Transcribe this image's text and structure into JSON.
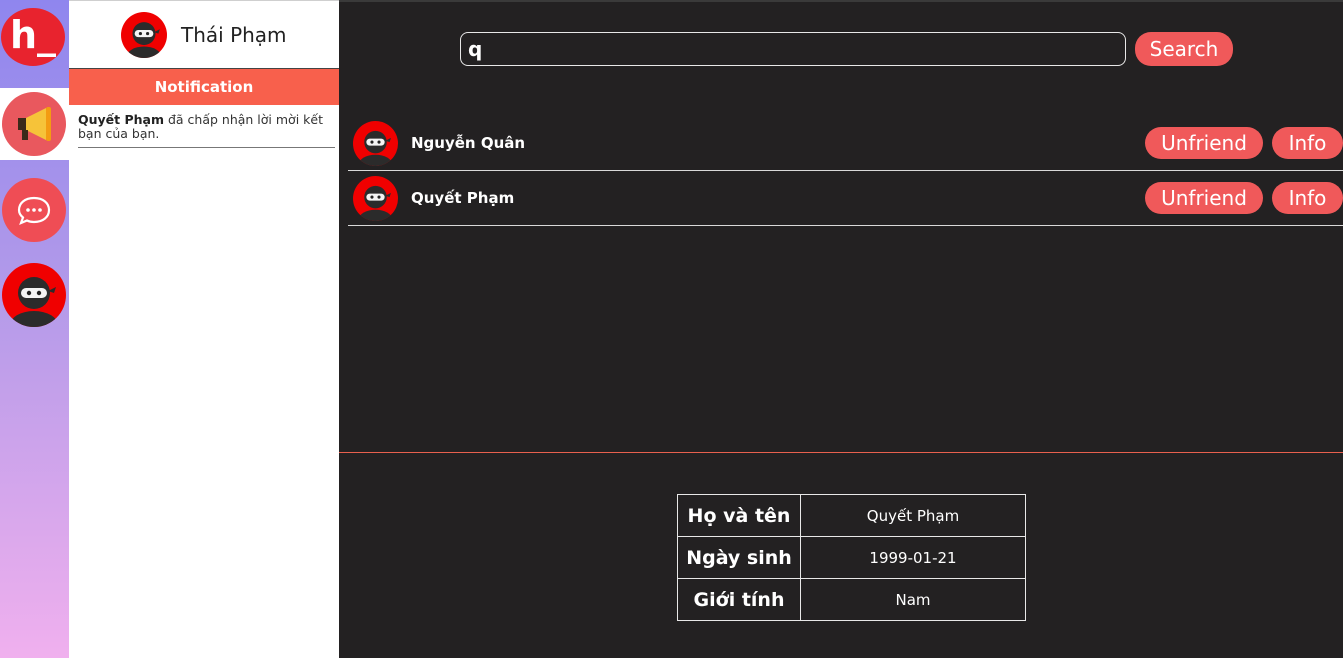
{
  "app": {
    "logo_text": "h_"
  },
  "rail": {
    "items": [
      {
        "icon": "megaphone-icon",
        "active": true
      },
      {
        "icon": "chat-bubble-icon",
        "active": false
      },
      {
        "icon": "ninja-avatar-icon",
        "active": false
      }
    ]
  },
  "panel": {
    "username": "Thái Phạm",
    "section_title": "Notification",
    "notifications": [
      {
        "actor": "Quyết Phạm",
        "message": " đã chấp nhận lời mời kết bạn của bạn."
      }
    ]
  },
  "search": {
    "value": "q",
    "button_label": "Search"
  },
  "friends": [
    {
      "name": "Nguyễn Quân",
      "unfriend_label": "Unfriend",
      "info_label": "Info"
    },
    {
      "name": "Quyết Phạm",
      "unfriend_label": "Unfriend",
      "info_label": "Info"
    }
  ],
  "profile_info": [
    {
      "label": "Họ và tên",
      "value": "Quyết Phạm"
    },
    {
      "label": "Ngày sinh",
      "value": "1999-01-21"
    },
    {
      "label": "Giới tính",
      "value": "Nam"
    }
  ],
  "colors": {
    "accent": "#f0595a",
    "section": "#f8604c",
    "background": "#232122",
    "avatar": "#f00000"
  }
}
